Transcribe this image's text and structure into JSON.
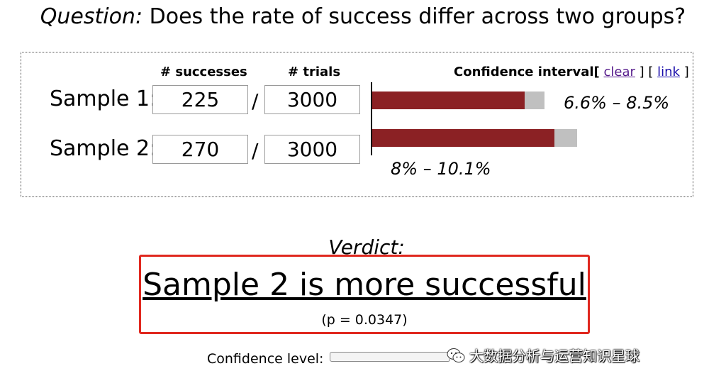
{
  "question": {
    "label": "Question:",
    "text": "Does the rate of success differ across two groups?"
  },
  "table": {
    "col_successes": "# successes",
    "col_trials": "# trials",
    "rows": [
      {
        "label": "Sample 1:",
        "successes": "225",
        "trials": "3000"
      },
      {
        "label": "Sample 2:",
        "successes": "270",
        "trials": "3000"
      }
    ],
    "separator": "/"
  },
  "ci": {
    "title": "Confidence interval",
    "bracket_open": "[",
    "clear": "clear",
    "bracket_mid": "] [",
    "link": "link",
    "bracket_close": "]",
    "sample1_range": "6.6% – 8.5%",
    "sample2_range": "8% – 10.1%",
    "sample1": {
      "low": 6.6,
      "high": 8.5
    },
    "sample2": {
      "low": 8.0,
      "high": 10.1
    },
    "colors": {
      "rate": "#8b2124",
      "interval": "#c0c0c0"
    }
  },
  "verdict": {
    "label": "Verdict:",
    "text": "Sample 2 is more successful",
    "pvalue": "(p = 0.0347)",
    "box_color": "#e0281f"
  },
  "confidence": {
    "label": "Confidence level:"
  },
  "watermark": {
    "text": "大数据分析与运营知识星球",
    "icon": "wechat-icon"
  }
}
